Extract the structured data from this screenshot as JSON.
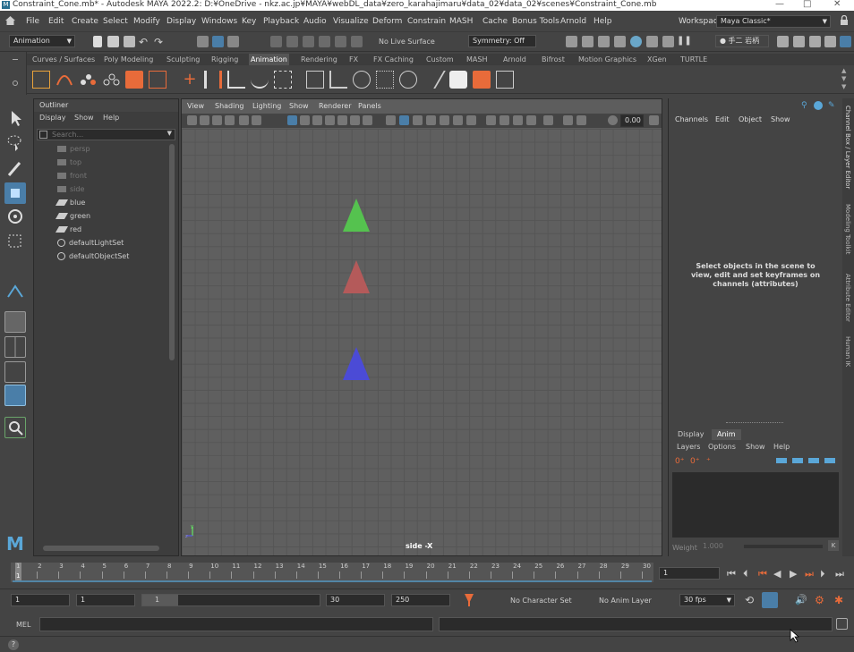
{
  "window": {
    "title": "Constraint_Cone.mb* - Autodesk MAYA 2022.2: D:¥OneDrive - nkz.ac.jp¥MAYA¥webDL_data¥zero_karahajimaru¥data_02¥data_02¥scenes¥Constraint_Cone.mb",
    "minimize": "—",
    "maximize": "□",
    "close": "✕"
  },
  "menubar": {
    "items": [
      "File",
      "Edit",
      "Create",
      "Select",
      "Modify",
      "Display",
      "Windows",
      "Key",
      "Playback",
      "Audio",
      "Visualize",
      "Deform",
      "Constrain",
      "MASH",
      "Cache",
      "Bonus Tools",
      "Arnold",
      "Help"
    ],
    "workspace_label": "Workspace:",
    "workspace_value": "Maya Classic*"
  },
  "toolrow": {
    "menuset": "Animation",
    "live_surface": "No Live Surface",
    "symmetry": "Symmetry: Off",
    "user": "手二 岩柄"
  },
  "shelf": {
    "tabs": [
      "Curves / Surfaces",
      "Poly Modeling",
      "Sculpting",
      "Rigging",
      "Animation",
      "Rendering",
      "FX",
      "FX Caching",
      "Custom",
      "MASH",
      "Arnold",
      "Bifrost",
      "Motion Graphics",
      "XGen",
      "TURTLE"
    ],
    "active_tab": "Animation"
  },
  "outliner": {
    "title": "Outliner",
    "menu": [
      "Display",
      "Show",
      "Help"
    ],
    "search_placeholder": "Search...",
    "items": [
      {
        "label": "persp",
        "type": "camera",
        "dim": true
      },
      {
        "label": "top",
        "type": "camera",
        "dim": true
      },
      {
        "label": "front",
        "type": "camera",
        "dim": true
      },
      {
        "label": "side",
        "type": "camera",
        "dim": true
      },
      {
        "label": "blue",
        "type": "mesh",
        "dim": false
      },
      {
        "label": "green",
        "type": "mesh",
        "dim": false
      },
      {
        "label": "red",
        "type": "mesh",
        "dim": false
      },
      {
        "label": "defaultLightSet",
        "type": "set",
        "dim": false
      },
      {
        "label": "defaultObjectSet",
        "type": "set",
        "dim": false
      }
    ]
  },
  "viewport": {
    "menu": [
      "View",
      "Shading",
      "Lighting",
      "Show",
      "Renderer",
      "Panels"
    ],
    "exposure_value": "0.00",
    "camera_label": "side -X",
    "cones": [
      {
        "name": "green-cone",
        "color": "#55c24f"
      },
      {
        "name": "red-cone",
        "color": "#b45a5a"
      },
      {
        "name": "blue-cone",
        "color": "#4b4bd6"
      }
    ]
  },
  "channelbox": {
    "menu": [
      "Channels",
      "Edit",
      "Object",
      "Show"
    ],
    "message": "Select objects in the scene to view, edit and set keyframes on channels (attributes)",
    "layer_tabs": [
      "Display",
      "Anim"
    ],
    "active_layer_tab": "Anim",
    "layer_menu": [
      "Layers",
      "Options",
      "Show",
      "Help"
    ],
    "weight_label": "Weight",
    "weight_value": "1.000",
    "side_tabs": [
      "Channel Box / Layer Editor",
      "Modeling Toolkit",
      "Attribute Editor",
      "Human IK"
    ]
  },
  "timeline": {
    "ticks": [
      "1",
      "2",
      "3",
      "4",
      "5",
      "6",
      "7",
      "8",
      "9",
      "10",
      "11",
      "12",
      "13",
      "14",
      "15",
      "16",
      "17",
      "18",
      "19",
      "20",
      "21",
      "22",
      "23",
      "24",
      "25",
      "26",
      "27",
      "28",
      "29",
      "30"
    ],
    "current_frame_field": "1",
    "current_frame": "1"
  },
  "range": {
    "start_outer": "1",
    "start_inner": "1",
    "slider_label": "1",
    "end_inner": "30",
    "end_outer": "250",
    "character_set": "No Character Set",
    "anim_layer": "No Anim Layer",
    "fps": "30 fps"
  },
  "cmdline": {
    "label": "MEL"
  },
  "status": {
    "help_icon": "?"
  },
  "colors": {
    "accent_blue": "#5285a6",
    "active_tool": "#4a7ea8"
  }
}
